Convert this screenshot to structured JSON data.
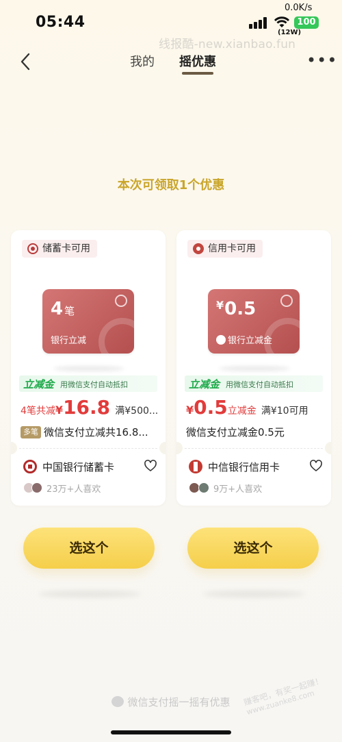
{
  "status_bar": {
    "time": "05:44",
    "net_speed": "0.0K/s",
    "wifi_label": "(12W)",
    "battery": "100"
  },
  "watermark_top": "线报酷-new.xianbao.fun",
  "nav": {
    "tab_mine": "我的",
    "tab_shake": "摇优惠",
    "active_tab": "摇优惠"
  },
  "headline": "本次可领取1个优惠",
  "cards": [
    {
      "tag": "储蓄卡可用",
      "coupon_big": "4",
      "coupon_big_unit": "笔",
      "coupon_sub": "银行立减",
      "lijian_title": "立减金",
      "lijian_desc": "用微信支付自动抵扣",
      "amount_prefix": "4笔共减",
      "amount_yen": "¥",
      "amount_value": "16.8",
      "amount_cond": "满¥500...",
      "badge": "多笔",
      "desc": "微信支付立减共16.8...",
      "bank": "中国银行储蓄卡",
      "likes": "23万+人喜欢",
      "button": "选这个"
    },
    {
      "tag": "信用卡可用",
      "coupon_yen": "¥",
      "coupon_big": "0.5",
      "coupon_sub": "银行立减金",
      "lijian_title": "立减金",
      "lijian_desc": "用微信支付自动抵扣",
      "amount_yen": "¥",
      "amount_value": "0.5",
      "amount_suffix": "立减金",
      "amount_cond": "满¥10可用",
      "desc": "微信支付立减金0.5元",
      "bank": "中信银行信用卡",
      "likes": "9万+人喜欢",
      "button": "选这个"
    }
  ],
  "footer": "微信支付摇一摇有优惠",
  "watermark_bottom": {
    "line1": "赚客吧，有奖一起赚！",
    "line2": "www.zuanke8.com"
  },
  "colors": {
    "accent_gold": "#c9a52a",
    "button_yellow": "#f5cf4a",
    "price_red": "#e23b3b",
    "lijian_green": "#1faa4b",
    "coupon_red": "#b4504f"
  },
  "icons": [
    "back-icon",
    "more-icon",
    "signal-icon",
    "wifi-icon",
    "battery-icon",
    "debit-card-icon",
    "credit-card-icon",
    "heart-icon",
    "boc-logo-icon",
    "citic-logo-icon",
    "wechat-pay-icon"
  ]
}
